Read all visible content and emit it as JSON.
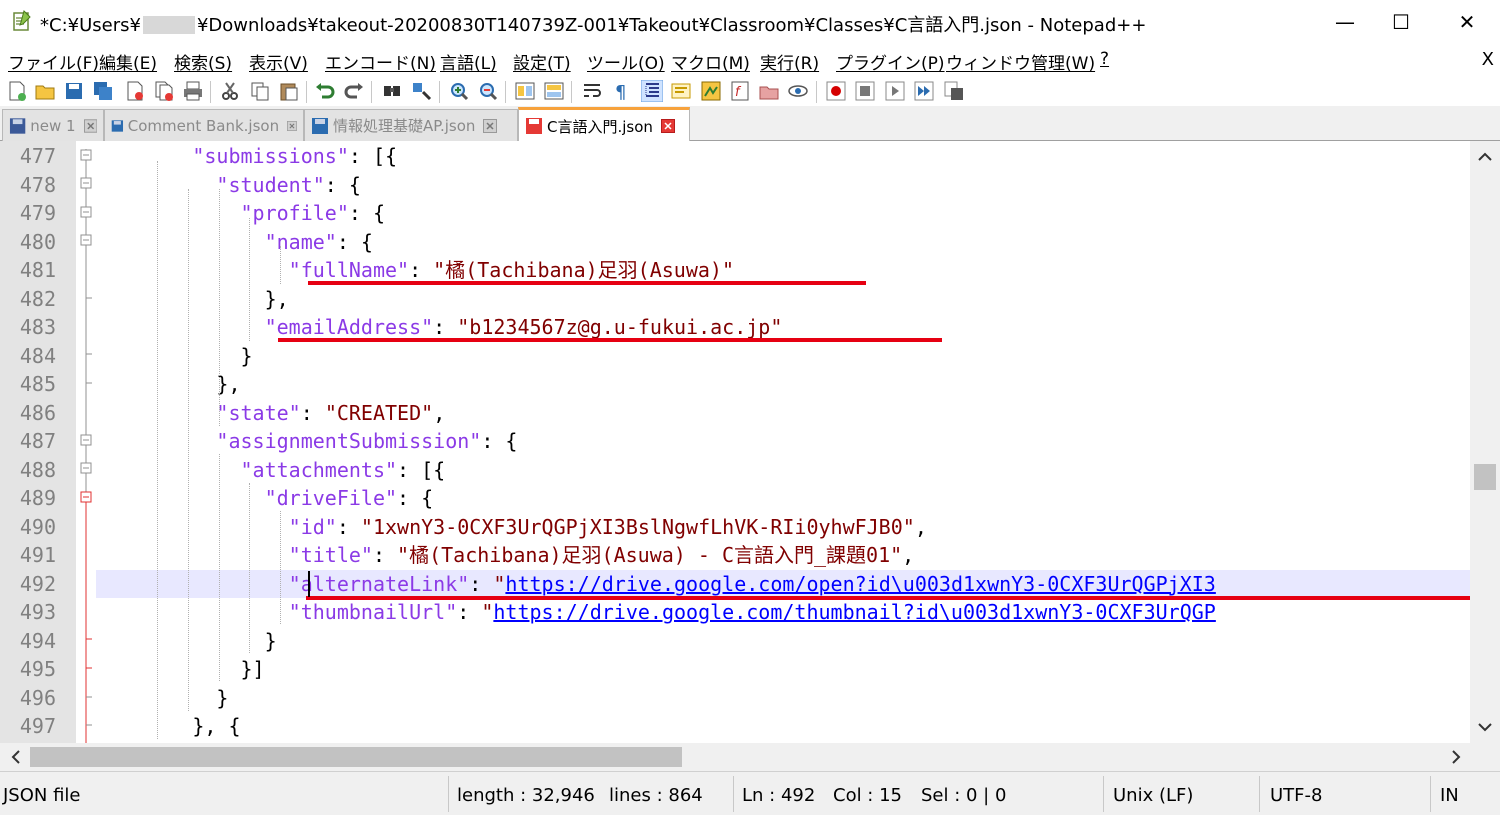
{
  "window": {
    "title_prefix": "*C:¥Users¥",
    "title_suffix": "¥Downloads¥takeout-20200830T140739Z-001¥Takeout¥Classroom¥Classes¥C言語入門.json - Notepad++",
    "minimize": "—",
    "maximize": "☐",
    "close": "✕"
  },
  "menu": {
    "items": [
      "ファイル(F)",
      "編集(E)",
      "検索(S)",
      "表示(V)",
      "エンコード(N)",
      "言語(L)",
      "設定(T)",
      "ツール(O)",
      "マクロ(M)",
      "実行(R)",
      "プラグイン(P)",
      "ウィンドウ管理(W)",
      "?"
    ],
    "close": "X"
  },
  "tabs": [
    {
      "label": "new 1",
      "active": false,
      "modified": false
    },
    {
      "label": "Comment Bank.json",
      "active": false,
      "modified": false
    },
    {
      "label": "情報処理基礎AP.json",
      "active": false,
      "modified": false
    },
    {
      "label": "C言語入門.json",
      "active": true,
      "modified": true
    }
  ],
  "editor": {
    "current_line": 492,
    "lines": [
      {
        "n": "477",
        "tokens": [
          [
            "p",
            "        "
          ],
          [
            "k",
            "\"submissions\""
          ],
          [
            "p",
            ": [{"
          ]
        ]
      },
      {
        "n": "478",
        "tokens": [
          [
            "p",
            "          "
          ],
          [
            "k",
            "\"student\""
          ],
          [
            "p",
            ": {"
          ]
        ]
      },
      {
        "n": "479",
        "tokens": [
          [
            "p",
            "            "
          ],
          [
            "k",
            "\"profile\""
          ],
          [
            "p",
            ": {"
          ]
        ]
      },
      {
        "n": "480",
        "tokens": [
          [
            "p",
            "              "
          ],
          [
            "k",
            "\"name\""
          ],
          [
            "p",
            ": {"
          ]
        ]
      },
      {
        "n": "481",
        "tokens": [
          [
            "p",
            "                "
          ],
          [
            "k",
            "\"fullName\""
          ],
          [
            "p",
            ": "
          ],
          [
            "s",
            "\"橘(Tachibana)足羽(Asuwa)\""
          ]
        ]
      },
      {
        "n": "482",
        "tokens": [
          [
            "p",
            "              },"
          ]
        ]
      },
      {
        "n": "483",
        "tokens": [
          [
            "p",
            "              "
          ],
          [
            "k",
            "\"emailAddress\""
          ],
          [
            "p",
            ": "
          ],
          [
            "s",
            "\"b1234567z@g.u-fukui.ac.jp\""
          ]
        ]
      },
      {
        "n": "484",
        "tokens": [
          [
            "p",
            "            }"
          ]
        ]
      },
      {
        "n": "485",
        "tokens": [
          [
            "p",
            "          },"
          ]
        ]
      },
      {
        "n": "486",
        "tokens": [
          [
            "p",
            "          "
          ],
          [
            "k",
            "\"state\""
          ],
          [
            "p",
            ": "
          ],
          [
            "s",
            "\"CREATED\""
          ],
          [
            "p",
            ","
          ]
        ]
      },
      {
        "n": "487",
        "tokens": [
          [
            "p",
            "          "
          ],
          [
            "k",
            "\"assignmentSubmission\""
          ],
          [
            "p",
            ": {"
          ]
        ]
      },
      {
        "n": "488",
        "tokens": [
          [
            "p",
            "            "
          ],
          [
            "k",
            "\"attachments\""
          ],
          [
            "p",
            ": [{"
          ]
        ]
      },
      {
        "n": "489",
        "tokens": [
          [
            "p",
            "              "
          ],
          [
            "k",
            "\"driveFile\""
          ],
          [
            "p",
            ": {"
          ]
        ]
      },
      {
        "n": "490",
        "tokens": [
          [
            "p",
            "                "
          ],
          [
            "k",
            "\"id\""
          ],
          [
            "p",
            ": "
          ],
          [
            "s",
            "\"1xwnY3-0CXF3UrQGPjXI3BslNgwfLhVK-RIi0yhwFJB0\""
          ],
          [
            "p",
            ","
          ]
        ]
      },
      {
        "n": "491",
        "tokens": [
          [
            "p",
            "                "
          ],
          [
            "k",
            "\"title\""
          ],
          [
            "p",
            ": "
          ],
          [
            "s",
            "\"橘(Tachibana)足羽(Asuwa) - C言語入門_課題01\""
          ],
          [
            "p",
            ","
          ]
        ]
      },
      {
        "n": "492",
        "tokens": [
          [
            "p",
            "                "
          ],
          [
            "k",
            "\"alternateLink\""
          ],
          [
            "p",
            ": "
          ],
          [
            "s",
            "\""
          ],
          [
            "u",
            "https://drive.google.com/open?id\\u003d1xwnY3-0CXF3UrQGPjXI3"
          ]
        ]
      },
      {
        "n": "493",
        "tokens": [
          [
            "p",
            "                "
          ],
          [
            "k",
            "\"thumbnailUrl\""
          ],
          [
            "p",
            ": "
          ],
          [
            "s",
            "\""
          ],
          [
            "u",
            "https://drive.google.com/thumbnail?id\\u003d1xwnY3-0CXF3UrQGP"
          ]
        ]
      },
      {
        "n": "494",
        "tokens": [
          [
            "p",
            "              }"
          ]
        ]
      },
      {
        "n": "495",
        "tokens": [
          [
            "p",
            "            }]"
          ]
        ]
      },
      {
        "n": "496",
        "tokens": [
          [
            "p",
            "          }"
          ]
        ]
      },
      {
        "n": "497",
        "tokens": [
          [
            "p",
            "        }, {"
          ]
        ]
      }
    ]
  },
  "status": {
    "file_type": "JSON file",
    "length": "length : 32,946",
    "lines": "lines : 864",
    "ln": "Ln : 492",
    "col": "Col : 15",
    "sel": "Sel : 0 | 0",
    "eol": "Unix (LF)",
    "encoding": "UTF-8",
    "mode": "IN"
  },
  "colors": {
    "keyword": "#8b3ae6",
    "string": "#800000",
    "link": "#0000ff",
    "highlight_underline": "#e60012",
    "active_tab_accent": "#f7a23c",
    "current_line_bg": "#e8e8ff"
  }
}
